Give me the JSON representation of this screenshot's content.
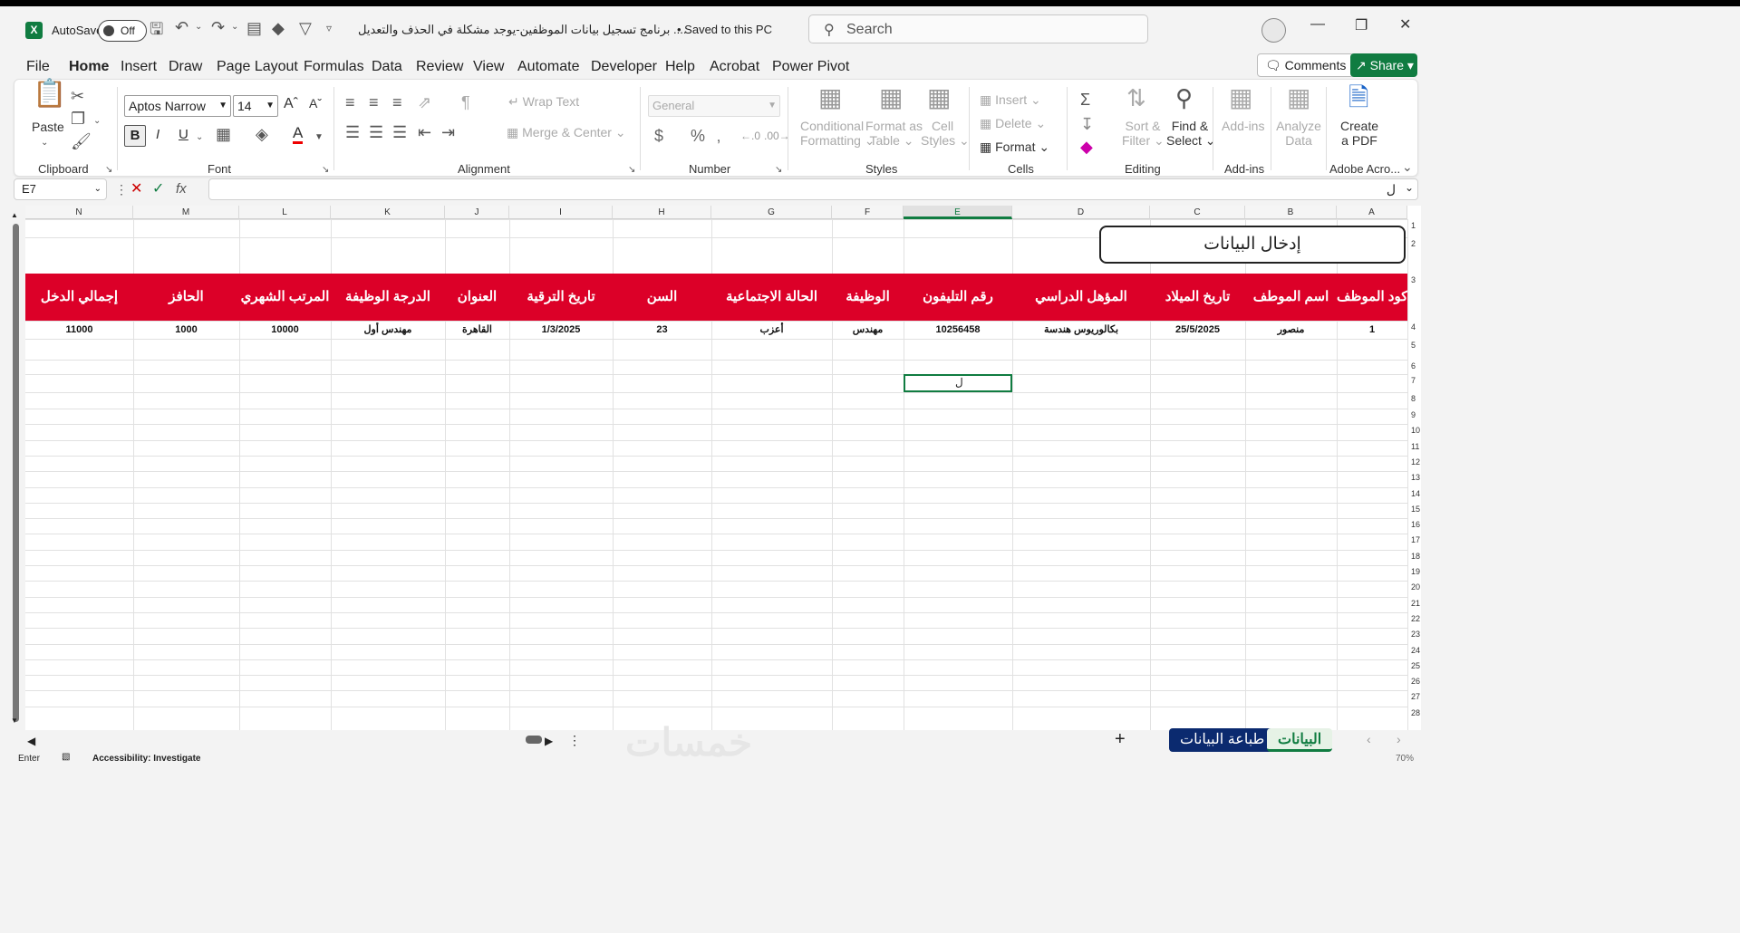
{
  "titlebar": {
    "autosave_label": "AutoSave",
    "autosave_state": "Off",
    "filename": "برنامج تسجيل بيانات الموظفين-يوجد مشكلة في الحذف والتعديل ....",
    "saved_status": "• Saved to this PC",
    "search_placeholder": "Search"
  },
  "menu": {
    "tabs": [
      "File",
      "Home",
      "Insert",
      "Draw",
      "Page Layout",
      "Formulas",
      "Data",
      "Review",
      "View",
      "Automate",
      "Developer",
      "Help",
      "Acrobat",
      "Power Pivot"
    ],
    "active": "Home",
    "comments_label": "Comments",
    "share_label": "Share"
  },
  "ribbon": {
    "clipboard": {
      "paste": "Paste",
      "label": "Clipboard"
    },
    "font": {
      "name": "Aptos Narrow",
      "size": "14",
      "label": "Font"
    },
    "alignment": {
      "wrap": "Wrap Text",
      "merge": "Merge & Center",
      "label": "Alignment"
    },
    "number": {
      "format": "General",
      "label": "Number"
    },
    "styles": {
      "conditional1": "Conditional",
      "conditional2": "Formatting",
      "table1": "Format as",
      "table2": "Table",
      "cell1": "Cell",
      "cell2": "Styles",
      "label": "Styles"
    },
    "cells": {
      "insert": "Insert",
      "delete": "Delete",
      "format": "Format",
      "label": "Cells"
    },
    "editing": {
      "sort1": "Sort &",
      "sort2": "Filter",
      "find1": "Find &",
      "find2": "Select",
      "label": "Editing"
    },
    "addins": {
      "addins": "Add-ins",
      "label": "Add-ins"
    },
    "analyze": {
      "a1": "Analyze",
      "a2": "Data"
    },
    "pdf": {
      "p1": "Create",
      "p2": "a PDF",
      "label": "Adobe Acro..."
    }
  },
  "formula": {
    "namebox": "E7",
    "content": "ل"
  },
  "sheet": {
    "columns": [
      "N",
      "M",
      "L",
      "K",
      "J",
      "I",
      "H",
      "G",
      "F",
      "E",
      "D",
      "C",
      "B",
      "A"
    ],
    "selected_column": "E",
    "rows": [
      "1",
      "2",
      "3",
      "4",
      "5",
      "6",
      "7",
      "8",
      "9",
      "10",
      "11",
      "12",
      "13",
      "14",
      "15",
      "16",
      "17",
      "18",
      "19",
      "20",
      "21",
      "22",
      "23",
      "24",
      "25",
      "26",
      "27",
      "28"
    ],
    "title_box": "إدخال البيانات",
    "headers": [
      "إجمالي الدخل",
      "الحافز",
      "المرتب الشهري",
      "الدرجة الوظيفة",
      "العنوان",
      "تاريخ الترقية",
      "السن",
      "الحالة الاجتماعية",
      "الوظيفة",
      "رقم التليفون",
      "المؤهل الدراسي",
      "تاريخ الميلاد",
      "اسم الموطف",
      "كود الموظف"
    ],
    "data_row": [
      "11000",
      "1000",
      "10000",
      "مهندس أول",
      "القاهرة",
      "1/3/2025",
      "23",
      "أعزب",
      "مهندس",
      "10256458",
      "بكالوريوس هندسة",
      "25/5/2025",
      "منصور",
      "1"
    ],
    "active_cell_text": "ل",
    "header_color": "#dc0028"
  },
  "tabs": {
    "sheets": [
      "البيانات",
      "طباعة البيانات"
    ],
    "active_sheet": "البيانات",
    "print_tab_color": "#0b2a6f",
    "watermark": "خمسات"
  },
  "status": {
    "mode": "Enter",
    "accessibility": "Accessibility: Investigate",
    "zoom": "70%"
  }
}
